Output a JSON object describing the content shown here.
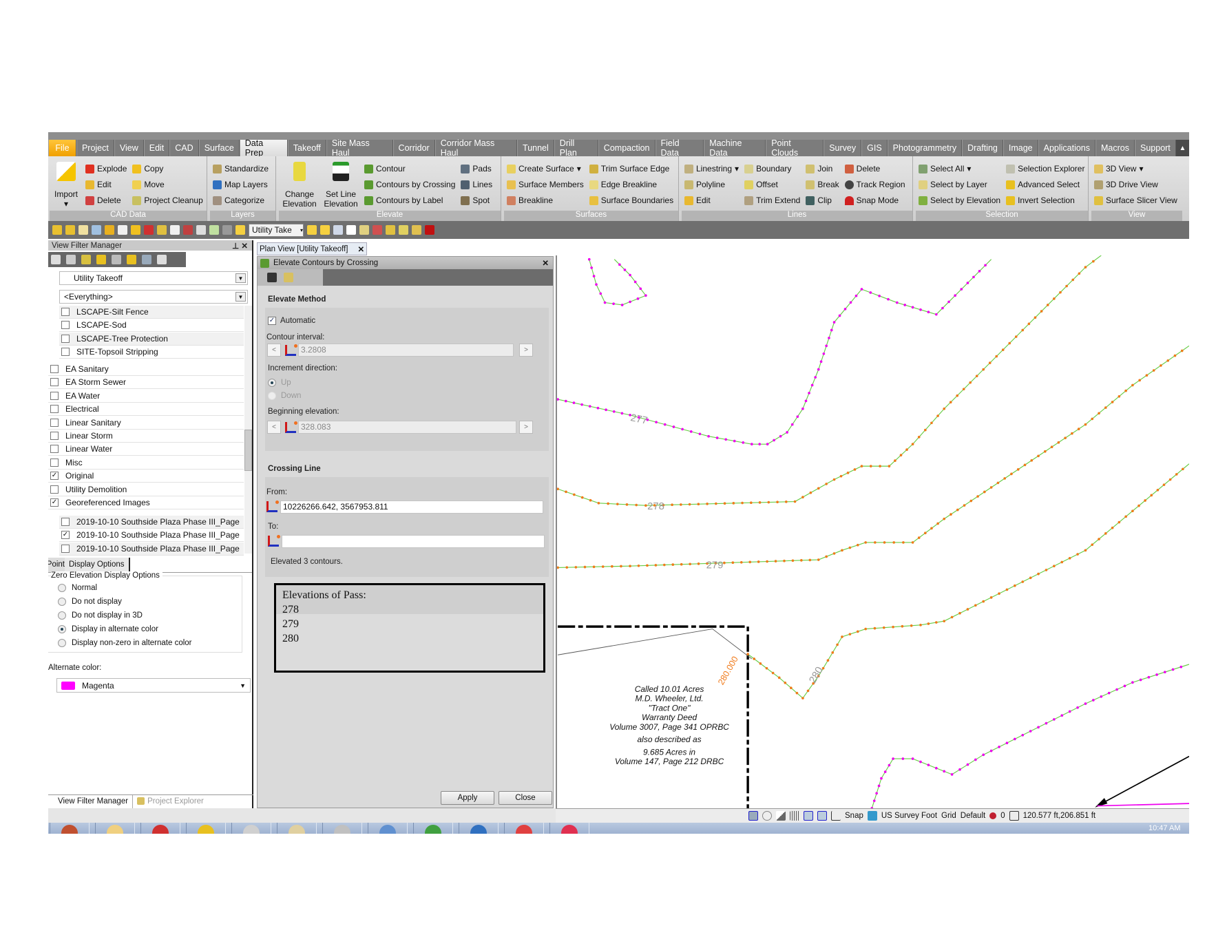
{
  "ribbon": {
    "tabs": [
      "File",
      "Project",
      "View",
      "Edit",
      "CAD",
      "Surface",
      "Data Prep",
      "Takeoff",
      "Site Mass Haul",
      "Corridor",
      "Corridor Mass Haul",
      "Tunnel",
      "Drill Plan",
      "Compaction",
      "Field Data",
      "Machine Data",
      "Point Clouds",
      "Survey",
      "GIS",
      "Photogrammetry",
      "Drafting",
      "Image",
      "Applications",
      "Macros",
      "Support"
    ],
    "active_tab": "Data Prep",
    "groups": {
      "cad_data": {
        "label": "CAD Data",
        "import": "Import",
        "explode": "Explode",
        "copy": "Copy",
        "edit": "Edit",
        "move": "Move",
        "delete": "Delete",
        "project_cleanup": "Project Cleanup"
      },
      "layers": {
        "label": "Layers",
        "standardize": "Standardize",
        "map_layers": "Map Layers",
        "categorize": "Categorize"
      },
      "elevate": {
        "label": "Elevate",
        "change_elevation": "Change Elevation",
        "set_line_elevation": "Set Line Elevation",
        "contour": "Contour",
        "contours_by_crossing": "Contours by Crossing",
        "contours_by_label": "Contours by Label",
        "pads": "Pads",
        "lines": "Lines",
        "spot": "Spot"
      },
      "surfaces": {
        "label": "Surfaces",
        "create_surface": "Create Surface",
        "surface_members": "Surface Members",
        "breakline": "Breakline",
        "trim_surface_edge": "Trim Surface Edge",
        "edge_breakline": "Edge Breakline",
        "surface_boundaries": "Surface Boundaries"
      },
      "lines": {
        "label": "Lines",
        "linestring": "Linestring",
        "polyline": "Polyline",
        "edit": "Edit",
        "boundary": "Boundary",
        "offset": "Offset",
        "trim_extend": "Trim Extend",
        "join": "Join",
        "break": "Break",
        "clip": "Clip",
        "delete": "Delete",
        "track_region": "Track Region",
        "snap_mode": "Snap Mode"
      },
      "selection": {
        "label": "Selection",
        "select_all": "Select All",
        "select_by_layer": "Select by Layer",
        "select_by_elevation": "Select by Elevation",
        "selection_explorer": "Selection Explorer",
        "advanced_select": "Advanced Select",
        "invert_selection": "Invert Selection"
      },
      "view": {
        "label": "View",
        "view_3d": "3D View",
        "drive_view": "3D Drive View",
        "slicer_view": "Surface Slicer View"
      }
    }
  },
  "toolbar": {
    "view_combo": "Utility Take"
  },
  "left_panel": {
    "title": "View Filter Manager",
    "view_filter": "Utility Takeoff",
    "layer_filter": "<Everything>",
    "layers_group1": [
      {
        "label": "LSCAPE-Silt Fence",
        "checked": false
      },
      {
        "label": "LSCAPE-Sod",
        "checked": false
      },
      {
        "label": "LSCAPE-Tree Protection",
        "checked": false
      },
      {
        "label": "SITE-Topsoil Stripping",
        "checked": false
      }
    ],
    "layers_group2": [
      {
        "label": "EA Sanitary",
        "checked": false
      },
      {
        "label": "EA Storm Sewer",
        "checked": false
      },
      {
        "label": "EA Water",
        "checked": false
      },
      {
        "label": "Electrical",
        "checked": false
      },
      {
        "label": "Linear Sanitary",
        "checked": false
      },
      {
        "label": "Linear Storm",
        "checked": false
      },
      {
        "label": "Linear Water",
        "checked": false
      },
      {
        "label": "Misc",
        "checked": false
      },
      {
        "label": "Original",
        "checked": true
      },
      {
        "label": "Utility Demolition",
        "checked": false
      },
      {
        "label": "Georeferenced Images",
        "checked": true
      }
    ],
    "layers_group3": [
      {
        "label": "2019-10-10 Southside Plaza Phase III_Page",
        "checked": false
      },
      {
        "label": "2019-10-10 Southside Plaza Phase III_Page",
        "checked": true
      },
      {
        "label": "2019-10-10 Southside Plaza Phase III_Page",
        "checked": false
      }
    ],
    "tabs": [
      "Point",
      "Display Options"
    ],
    "zero_elev_title": "Zero Elevation Display Options",
    "zero_elev_options": [
      "Normal",
      "Do not display",
      "Do not display in 3D",
      "Display in alternate color",
      "Display non-zero in alternate color"
    ],
    "zero_elev_selected": 3,
    "alt_color_label": "Alternate color:",
    "alt_color": "Magenta",
    "alt_color_hex": "#ff00ff",
    "bottom_tabs": [
      "View Filter Manager",
      "Project Explorer"
    ]
  },
  "document_tab": "Plan View [Utility Takeoff]",
  "dialog": {
    "title": "Elevate Contours by Crossing",
    "elevate_method": "Elevate Method",
    "automatic": "Automatic",
    "automatic_checked": true,
    "contour_interval_label": "Contour interval:",
    "contour_interval": "3.2808",
    "increment_label": "Increment direction:",
    "up": "Up",
    "down": "Down",
    "beginning_label": "Beginning elevation:",
    "beginning_elevation": "328.083",
    "crossing_line": "Crossing Line",
    "from_label": "From:",
    "from_value": "10226266.642, 3567953.811",
    "to_label": "To:",
    "to_value": "",
    "result": "Elevated 3 contours.",
    "pass_title": "Elevations of Pass:",
    "pass_values": [
      "278",
      "279",
      "280"
    ],
    "apply": "Apply",
    "close": "Close",
    "nav_prev": "<",
    "nav_next": ">"
  },
  "map": {
    "contour_labels": [
      "277",
      "278",
      "279",
      "280",
      "280.000"
    ],
    "annotation": [
      "Called 10.01 Acres",
      "M.D. Wheeler, Ltd.",
      "\"Tract One\"",
      "Warranty Deed",
      "Volume 3007, Page 341 OPRBC",
      "also described as",
      "9.685 Acres in",
      "Volume 147, Page 212 DRBC"
    ],
    "colors": {
      "line": "#66cc44",
      "orange": "#f07a1a",
      "magenta": "#ee00ee",
      "label": "#999999"
    }
  },
  "status": {
    "snap": "Snap",
    "units": "US Survey Foot",
    "grid": "Grid",
    "default": "Default",
    "count": "0",
    "coords": "120.577 ft,206.851 ft"
  },
  "taskbar": {
    "time": "10:47 AM"
  }
}
